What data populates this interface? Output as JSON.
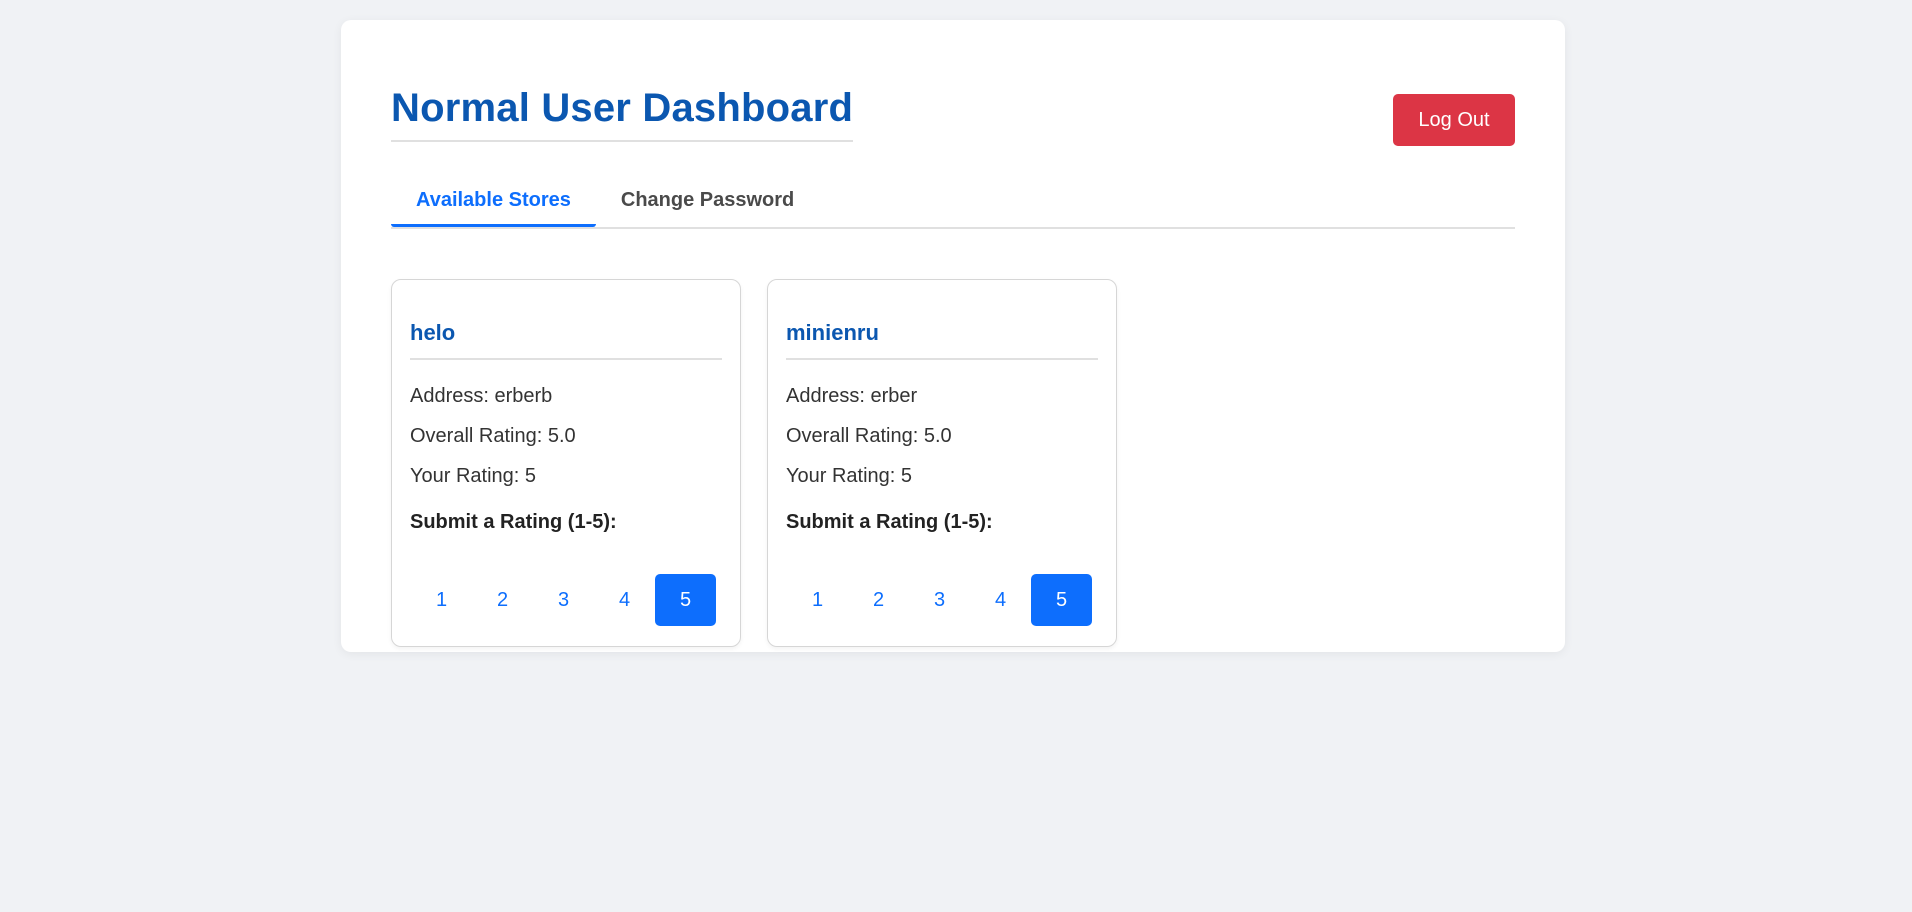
{
  "header": {
    "title": "Normal User Dashboard",
    "logout_label": "Log Out"
  },
  "tabs": [
    {
      "label": "Available Stores",
      "active": true
    },
    {
      "label": "Change Password",
      "active": false
    }
  ],
  "stores": [
    {
      "name": "helo",
      "address": "Address: erberb",
      "overall_rating": "Overall Rating: 5.0",
      "your_rating": "Your Rating: 5",
      "submit_label": "Submit a Rating (1-5):",
      "rating_options": [
        "1",
        "2",
        "3",
        "4",
        "5"
      ],
      "selected_rating": "5"
    },
    {
      "name": "minienru",
      "address": "Address: erber",
      "overall_rating": "Overall Rating: 5.0",
      "your_rating": "Your Rating: 5",
      "submit_label": "Submit a Rating (1-5):",
      "rating_options": [
        "1",
        "2",
        "3",
        "4",
        "5"
      ],
      "selected_rating": "5"
    }
  ],
  "colors": {
    "primary": "#0d6efd",
    "title": "#0b57b0",
    "danger": "#dc3545",
    "background": "#f0f2f5"
  }
}
